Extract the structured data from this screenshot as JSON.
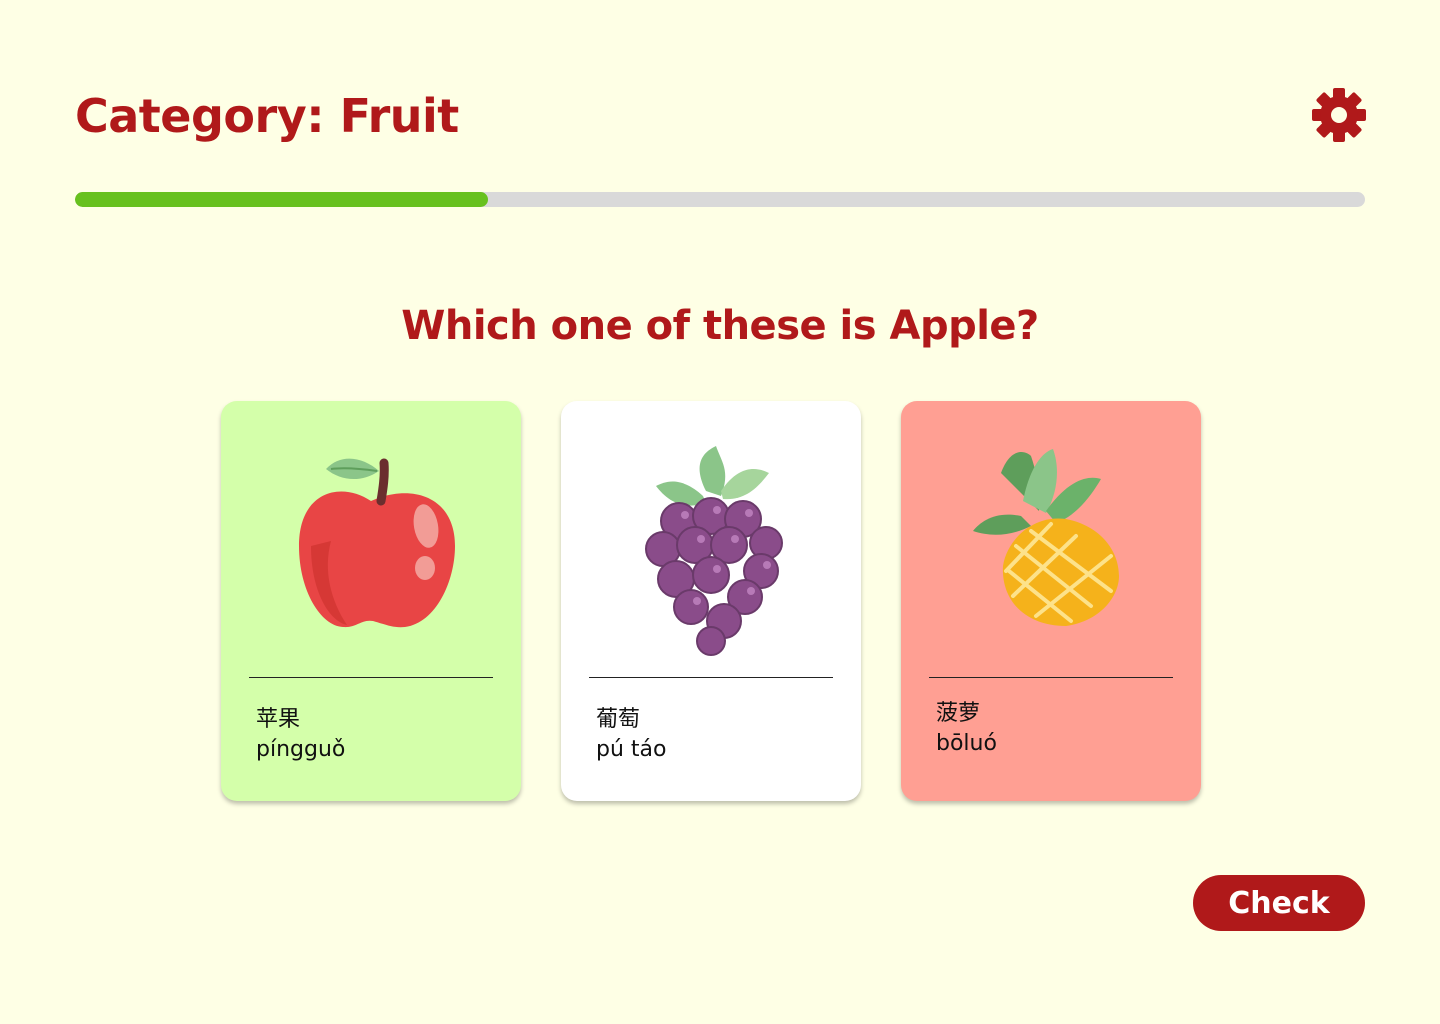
{
  "header": {
    "title": "Category: Fruit",
    "settings_icon": "gear-icon"
  },
  "progress": {
    "value": 0.32,
    "fill_color": "#67C11E",
    "track_color": "#D9D9D9"
  },
  "question": "Which one of these is Apple?",
  "options": [
    {
      "hanzi": "苹果",
      "pinyin": "píngguǒ",
      "icon": "apple-icon",
      "state": "correct",
      "bg": "#D4FFAA"
    },
    {
      "hanzi": "葡萄",
      "pinyin": "pú táo",
      "icon": "grapes-icon",
      "state": "neutral",
      "bg": "#FFFFFF"
    },
    {
      "hanzi": "菠萝",
      "pinyin": "bōluó",
      "icon": "pineapple-icon",
      "state": "wrong",
      "bg": "#FF9F93"
    }
  ],
  "actions": {
    "check_label": "Check"
  },
  "colors": {
    "accent": "#B0191A",
    "background": "#FEFFE5"
  }
}
